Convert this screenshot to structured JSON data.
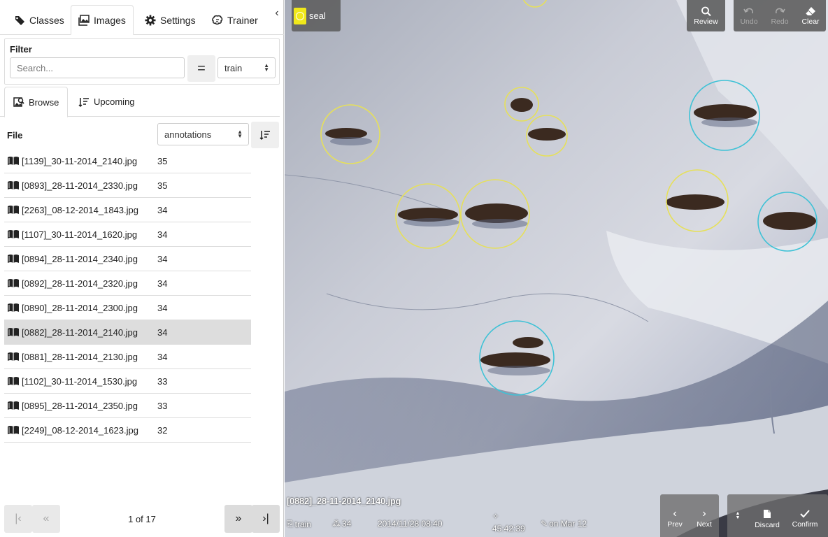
{
  "tabs": [
    {
      "label": "Classes",
      "icon": "tag-icon"
    },
    {
      "label": "Images",
      "icon": "images-icon"
    },
    {
      "label": "Settings",
      "icon": "gear-icon"
    },
    {
      "label": "Trainer",
      "icon": "brain-icon"
    }
  ],
  "active_tab": "Images",
  "filter": {
    "title": "Filter",
    "search_placeholder": "Search...",
    "operator": "=",
    "split_value": "train"
  },
  "subtabs": [
    {
      "label": "Browse",
      "icon": "browse-icon"
    },
    {
      "label": "Upcoming",
      "icon": "upcoming-icon"
    }
  ],
  "file_list": {
    "column_file": "File",
    "sort_field": "annotations",
    "rows": [
      {
        "name": "[1139]_30-11-2014_2140.jpg",
        "count": "35"
      },
      {
        "name": "[0893]_28-11-2014_2330.jpg",
        "count": "35"
      },
      {
        "name": "[2263]_08-12-2014_1843.jpg",
        "count": "34"
      },
      {
        "name": "[1107]_30-11-2014_1620.jpg",
        "count": "34"
      },
      {
        "name": "[0894]_28-11-2014_2340.jpg",
        "count": "34"
      },
      {
        "name": "[0892]_28-11-2014_2320.jpg",
        "count": "34"
      },
      {
        "name": "[0890]_28-11-2014_2300.jpg",
        "count": "34"
      },
      {
        "name": "[0882]_28-11-2014_2140.jpg",
        "count": "34"
      },
      {
        "name": "[0881]_28-11-2014_2130.jpg",
        "count": "34"
      },
      {
        "name": "[1102]_30-11-2014_1530.jpg",
        "count": "33"
      },
      {
        "name": "[0895]_28-11-2014_2350.jpg",
        "count": "33"
      },
      {
        "name": "[2249]_08-12-2014_1623.jpg",
        "count": "32"
      }
    ],
    "selected_index": 7
  },
  "pagination": {
    "label": "1 of 17",
    "first": "|‹",
    "prev": "«",
    "next": "»",
    "last": "›|"
  },
  "viewer": {
    "active_class": "seal",
    "class_color": "#f0e81a",
    "toolbar": {
      "review": "Review",
      "undo": "Undo",
      "redo": "Redo",
      "clear": "Clear"
    },
    "image_name": "[0882]_28-11-2014_2140.jpg",
    "info": {
      "split": "train",
      "annotation_count": "34",
      "timestamp": "2014/11/28 08:40",
      "duration": "45:42:39",
      "edited": "on Mar 12"
    },
    "nav": {
      "prev": "Prev",
      "next": "Next",
      "discard": "Discard",
      "confirm": "Confirm"
    },
    "annotation_colors": {
      "confirmed": "#e6e05a",
      "predicted": "#3fc2d6"
    }
  }
}
